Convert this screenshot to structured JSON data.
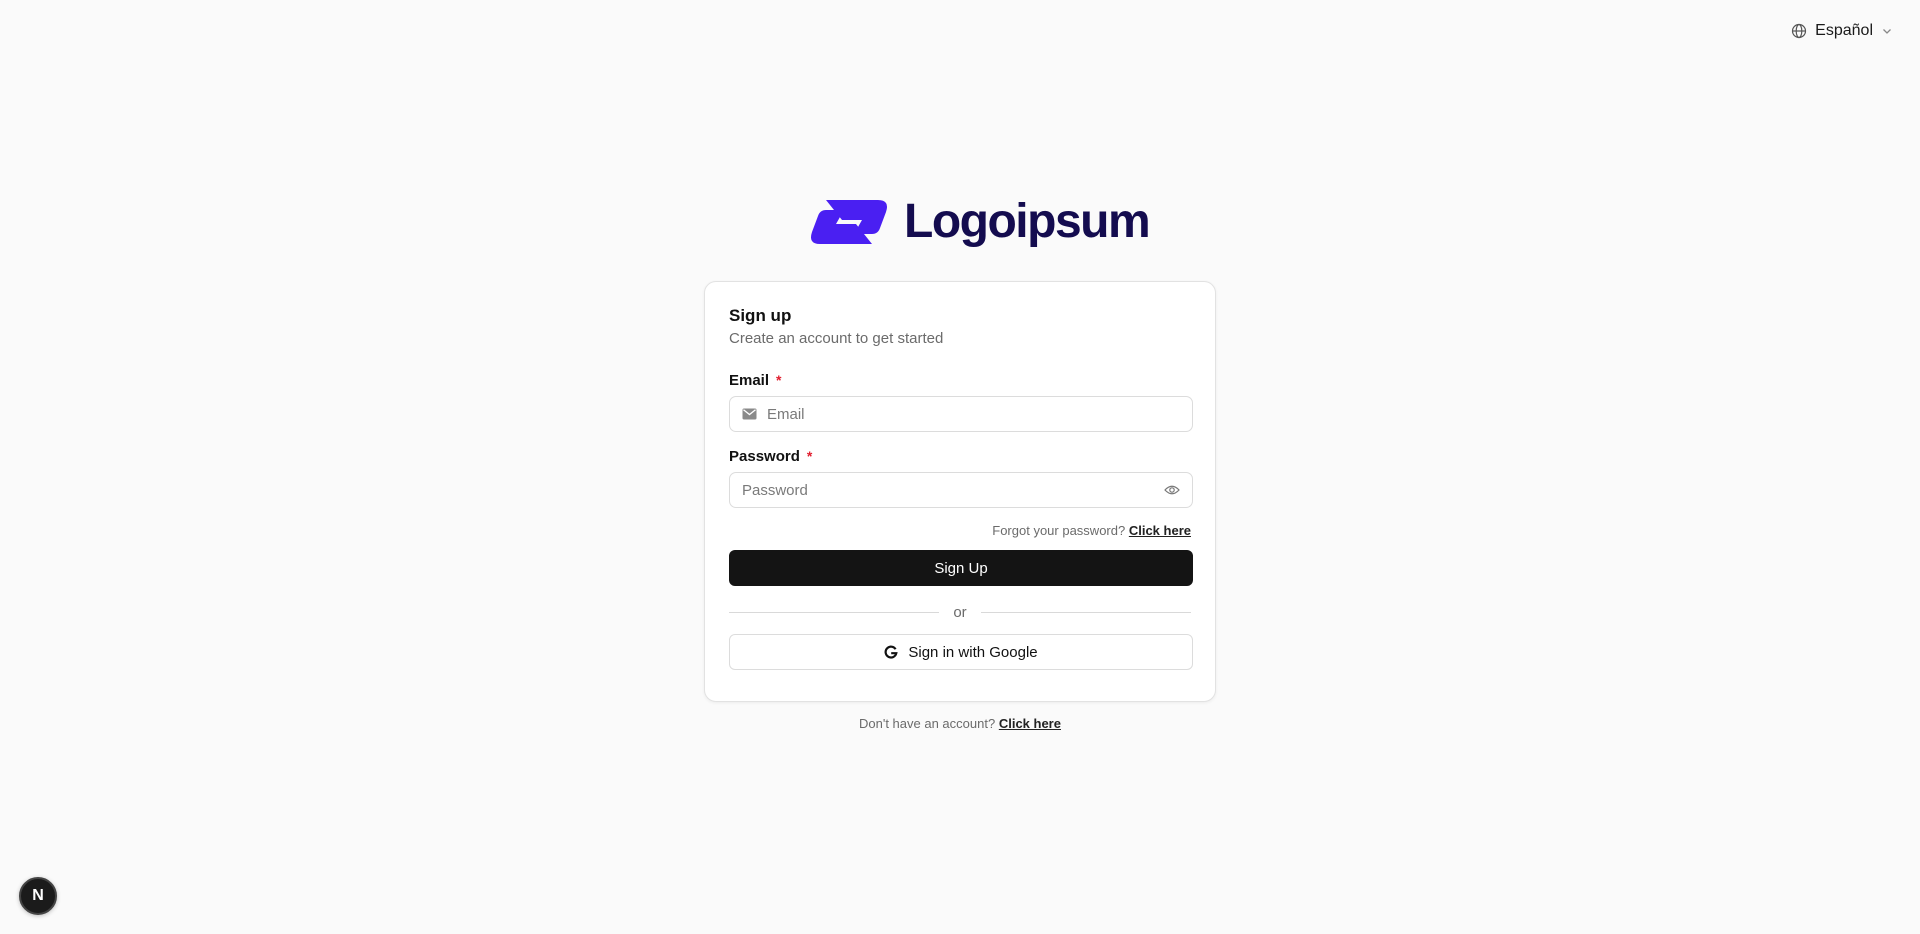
{
  "language": {
    "selected": "Español",
    "icon": "globe-icon"
  },
  "brand": {
    "name": "Logoipsum",
    "colors": {
      "mark": "#4a1ff2",
      "text": "#140c4f"
    }
  },
  "signup": {
    "title": "Sign up",
    "subtitle": "Create an account to get started",
    "email": {
      "label": "Email",
      "required_mark": "*",
      "placeholder": "Email",
      "value": ""
    },
    "password": {
      "label": "Password",
      "required_mark": "*",
      "placeholder": "Password",
      "value": ""
    },
    "forgot": {
      "text": "Forgot your password?",
      "link": "Click here"
    },
    "submit_label": "Sign Up",
    "divider_label": "or",
    "google_label": "Sign in with Google"
  },
  "footer": {
    "text": "Don't have an account?",
    "link": "Click here"
  },
  "dev_badge": {
    "label": "N"
  }
}
